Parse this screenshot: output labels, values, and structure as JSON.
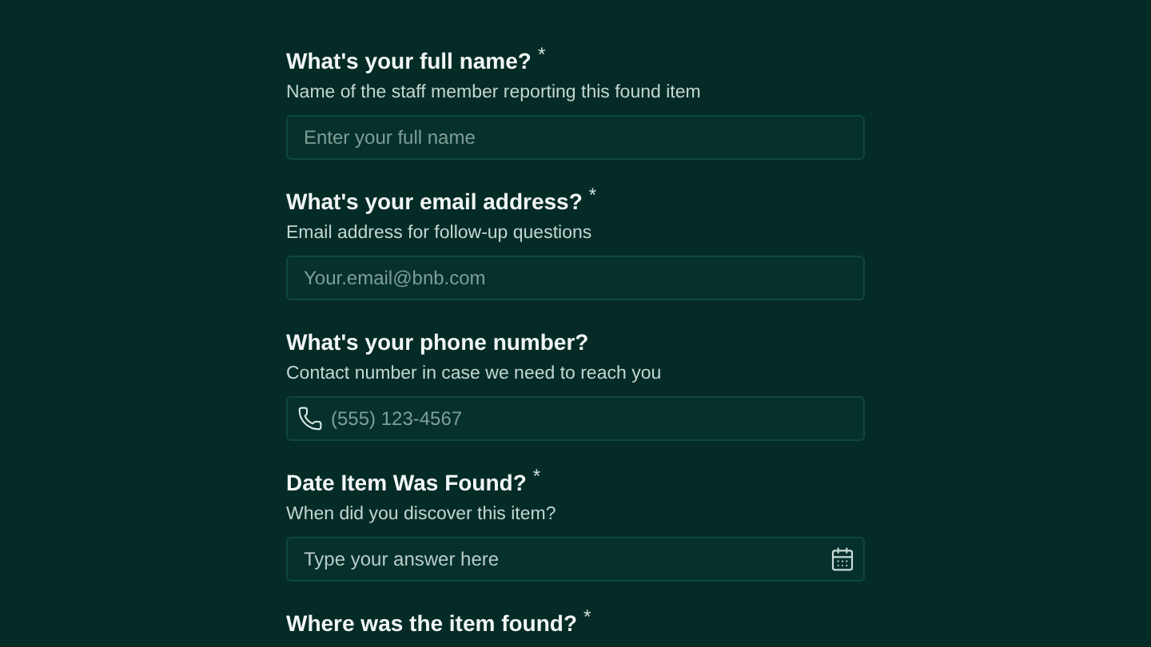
{
  "questions": [
    {
      "title": "What's your full name?",
      "required_mark": "*",
      "description": "Name of the staff member reporting this found item",
      "field": {
        "kind": "text",
        "placeholder": "Enter your full name"
      }
    },
    {
      "title": "What's your email address?",
      "required_mark": "*",
      "description": "Email address for follow-up questions",
      "field": {
        "kind": "text",
        "placeholder": "Your.email@bnb.com"
      }
    },
    {
      "title": "What's your phone number?",
      "description": "Contact number in case we need to reach you",
      "field": {
        "kind": "phone",
        "placeholder": "(555) 123-4567"
      }
    },
    {
      "title": "Date Item Was Found?",
      "required_mark": "*",
      "description": "When did you discover this item?",
      "field": {
        "kind": "date",
        "placeholder": "Type your answer here"
      }
    },
    {
      "title": "Where was the item found?",
      "required_mark": "*"
    }
  ]
}
